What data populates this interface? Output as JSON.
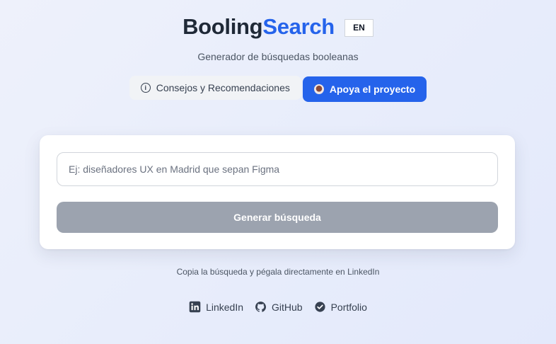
{
  "brand": {
    "part1": "Booling",
    "part2": "Search",
    "part1_color": "#1f2937",
    "part2_color": "#2563eb"
  },
  "language_button": "EN",
  "subtitle": "Generador de búsquedas booleanas",
  "actions": {
    "tips": {
      "label": "Consejos y Recomendaciones",
      "icon": "info-icon"
    },
    "support": {
      "label": "Apoya el proyecto",
      "icon": "coffee-icon",
      "color": "#2563eb"
    }
  },
  "search": {
    "placeholder": "Ej: diseñadores UX en Madrid que sepan Figma",
    "value": "",
    "submit_label": "Generar búsqueda",
    "submit_color": "#9ca3af"
  },
  "hint": "Copia la búsqueda y pégala directamente en LinkedIn",
  "footer": {
    "links": [
      {
        "label": "LinkedIn",
        "icon": "linkedin-icon"
      },
      {
        "label": "GitHub",
        "icon": "github-icon"
      },
      {
        "label": "Portfolio",
        "icon": "check-badge-icon"
      }
    ]
  }
}
